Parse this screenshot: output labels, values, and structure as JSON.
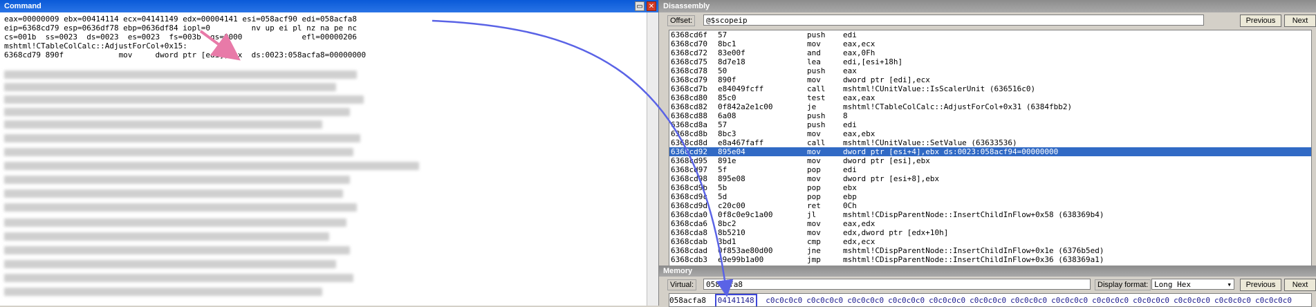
{
  "command": {
    "title": "Command",
    "lines": [
      "eax=00000009 ebx=00414114 ecx=04141149 edx=00004141 esi=058acf90 edi=058acfa8",
      "eip=6368cd79 esp=0636df78 ebp=0636df84 iopl=0         nv up ei pl nz na pe nc",
      "cs=001b  ss=0023  ds=0023  es=0023  fs=003b  gs=0000             efl=00000206",
      "mshtml!CTableColCalc::AdjustForCol+0x15:",
      "6368cd79 890f            mov     dword ptr [edi],ecx  ds:0023:058acfa8=00000000"
    ]
  },
  "disassembly": {
    "title": "Disassembly",
    "offset_label": "Offset:",
    "offset_value": "@$scopeip",
    "previous": "Previous",
    "next": "Next",
    "rows": [
      {
        "addr": "6368cd6f",
        "bytes": "57",
        "mn": "push",
        "op": "edi"
      },
      {
        "addr": "6368cd70",
        "bytes": "8bc1",
        "mn": "mov",
        "op": "eax,ecx"
      },
      {
        "addr": "6368cd72",
        "bytes": "83e00f",
        "mn": "and",
        "op": "eax,0Fh"
      },
      {
        "addr": "6368cd75",
        "bytes": "8d7e18",
        "mn": "lea",
        "op": "edi,[esi+18h]"
      },
      {
        "addr": "6368cd78",
        "bytes": "50",
        "mn": "push",
        "op": "eax"
      },
      {
        "addr": "6368cd79",
        "bytes": "890f",
        "mn": "mov",
        "op": "dword ptr [edi],ecx"
      },
      {
        "addr": "6368cd7b",
        "bytes": "e84049fcff",
        "mn": "call",
        "op": "mshtml!CUnitValue::IsScalerUnit (636516c0)"
      },
      {
        "addr": "6368cd80",
        "bytes": "85c0",
        "mn": "test",
        "op": "eax,eax"
      },
      {
        "addr": "6368cd82",
        "bytes": "0f842a2e1c00",
        "mn": "je",
        "op": "mshtml!CTableColCalc::AdjustForCol+0x31 (6384fbb2)"
      },
      {
        "addr": "6368cd88",
        "bytes": "6a08",
        "mn": "push",
        "op": "8"
      },
      {
        "addr": "6368cd8a",
        "bytes": "57",
        "mn": "push",
        "op": "edi"
      },
      {
        "addr": "6368cd8b",
        "bytes": "8bc3",
        "mn": "mov",
        "op": "eax,ebx"
      },
      {
        "addr": "6368cd8d",
        "bytes": "e8a467faff",
        "mn": "call",
        "op": "mshtml!CUnitValue::SetValue (63633536)"
      },
      {
        "addr": "6368cd92",
        "bytes": "895e04",
        "mn": "mov",
        "op": "dword ptr [esi+4],ebx ds:0023:058acf94=00000000"
      },
      {
        "addr": "6368cd95",
        "bytes": "891e",
        "mn": "mov",
        "op": "dword ptr [esi],ebx"
      },
      {
        "addr": "6368cd97",
        "bytes": "5f",
        "mn": "pop",
        "op": "edi"
      },
      {
        "addr": "6368cd98",
        "bytes": "895e08",
        "mn": "mov",
        "op": "dword ptr [esi+8],ebx"
      },
      {
        "addr": "6368cd9b",
        "bytes": "5b",
        "mn": "pop",
        "op": "ebx"
      },
      {
        "addr": "6368cd9c",
        "bytes": "5d",
        "mn": "pop",
        "op": "ebp"
      },
      {
        "addr": "6368cd9d",
        "bytes": "c20c00",
        "mn": "ret",
        "op": "0Ch"
      },
      {
        "addr": "6368cda0",
        "bytes": "0f8c0e9c1a00",
        "mn": "jl",
        "op": "mshtml!CDispParentNode::InsertChildInFlow+0x58 (638369b4)"
      },
      {
        "addr": "6368cda6",
        "bytes": "8bc2",
        "mn": "mov",
        "op": "eax,edx"
      },
      {
        "addr": "6368cda8",
        "bytes": "8b5210",
        "mn": "mov",
        "op": "edx,dword ptr [edx+10h]"
      },
      {
        "addr": "6368cdab",
        "bytes": "3bd1",
        "mn": "cmp",
        "op": "edx,ecx"
      },
      {
        "addr": "6368cdad",
        "bytes": "0f853ae80d00",
        "mn": "jne",
        "op": "mshtml!CDispParentNode::InsertChildInFlow+0x1e (6376b5ed)"
      },
      {
        "addr": "6368cdb3",
        "bytes": "e9e99b1a00",
        "mn": "jmp",
        "op": "mshtml!CDispParentNode::InsertChildInFlow+0x36 (638369a1)"
      }
    ],
    "selected_index": 13
  },
  "memory": {
    "title": "Memory",
    "virtual_label": "Virtual:",
    "virtual_value": "058acfa8",
    "display_format_label": "Display format:",
    "display_format_value": "Long Hex",
    "previous": "Previous",
    "next": "Next",
    "row_addr": "058acfa8",
    "highlight_value": "04141148",
    "values": [
      "c0c0c0c0",
      "c0c0c0c0",
      "c0c0c0c0",
      "c0c0c0c0",
      "c0c0c0c0",
      "c0c0c0c0",
      "c0c0c0c0",
      "c0c0c0c0",
      "c0c0c0c0",
      "c0c0c0c0",
      "c0c0c0c0",
      "c0c0c0c0",
      "c0c0c0c0"
    ]
  },
  "colors": {
    "selection": "#316ac5",
    "annotation_arrow": "#5a63e6",
    "annotation_pink": "#e87aa8"
  }
}
